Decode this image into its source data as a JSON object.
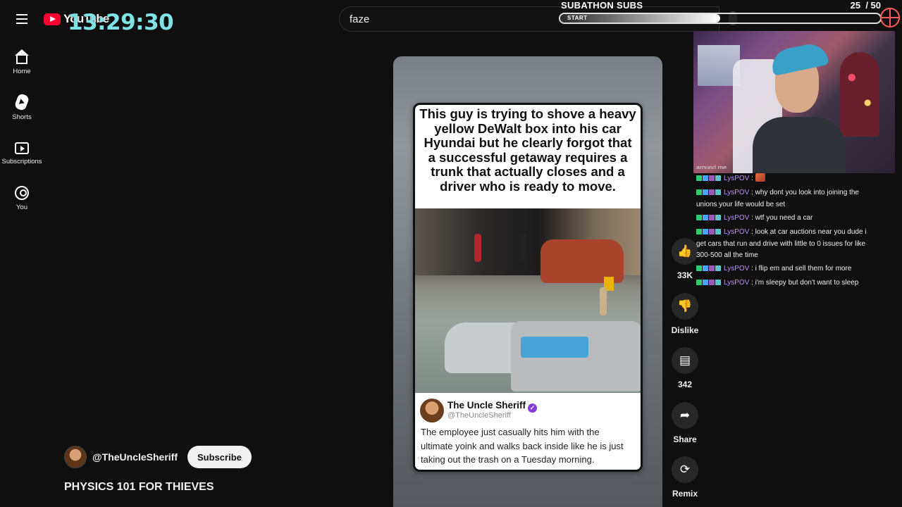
{
  "header": {
    "logo_text": "YouTube",
    "clock": "13:29:30",
    "search_value": "faze"
  },
  "subathon": {
    "title": "SUBATHON SUBS",
    "current": 25,
    "goal": 50,
    "count_text": "25",
    "goal_text": "/ 50",
    "start_label": "START",
    "progress": 0.5
  },
  "sidebar": {
    "items": [
      {
        "label": "Home",
        "icon": "home-icon"
      },
      {
        "label": "Shorts",
        "icon": "shorts-icon"
      },
      {
        "label": "Subscriptions",
        "icon": "subscriptions-icon"
      },
      {
        "label": "You",
        "icon": "you-icon"
      }
    ]
  },
  "video": {
    "caption": "This guy is trying to shove a heavy yellow DeWalt box into his car Hyundai but he clearly forgot that a successful getaway requires a trunk that actually closes and a driver who is ready to move.",
    "tweet": {
      "name": "The Uncle Sheriff",
      "handle": "@TheUncleSheriff",
      "text": "The employee just casually hits him with the ultimate yoink and walks back inside like he is just taking out the trash on a Tuesday morning."
    }
  },
  "actions": {
    "like_count": "33K",
    "dislike_label": "Dislike",
    "comment_count": "342",
    "share_label": "Share",
    "remix_label": "Remix"
  },
  "channel": {
    "name": "@TheUncleSheriff",
    "subscribe_label": "Subscribe",
    "video_title": "PHYSICS 101 FOR THIEVES"
  },
  "chat": {
    "cut_text": "around me",
    "messages": [
      {
        "user": "LysPOV",
        "text": "",
        "emote": true
      },
      {
        "user": "LysPOV",
        "text": "why dont you look into joining the unions your life would be set"
      },
      {
        "user": "LysPOV",
        "text": "wtf you need a car"
      },
      {
        "user": "LysPOV",
        "text": "look at car auctions near you dude i get cars that run and drive with little to 0 issues for like 300-500 all the time"
      },
      {
        "user": "LysPOV",
        "text": "i flip em and sell them for more"
      },
      {
        "user": "LysPOV",
        "text": "i'm sleepy but don't want to sleep"
      }
    ]
  },
  "colors": {
    "background": "#0f0f0f",
    "clock": "#7fe3e6",
    "chat_username": "#c78bff",
    "youtube_red": "#ff0033"
  }
}
